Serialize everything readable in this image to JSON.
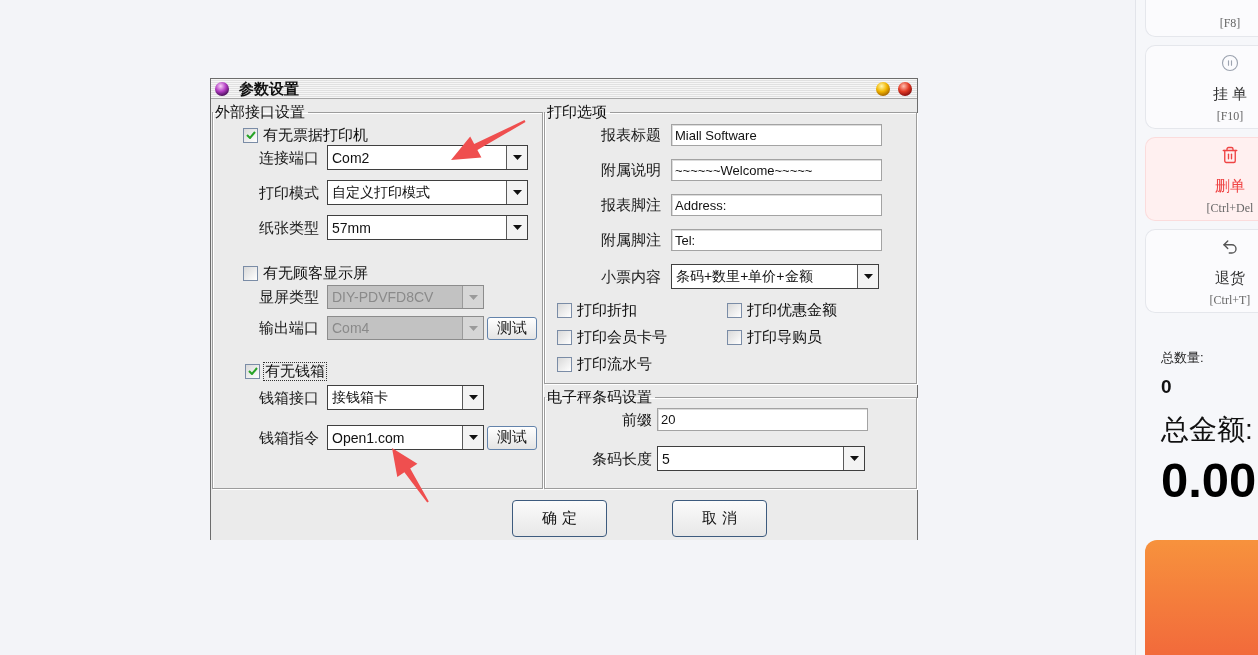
{
  "dialog": {
    "title": "参数设置",
    "interface_group": {
      "title": "外部接口设置",
      "sections": [
        {
          "checkbox": {
            "label": "有无票据打印机",
            "checked": true,
            "focused": false
          },
          "fields": [
            {
              "label": "连接端口",
              "value": "Com2",
              "disabled": false
            },
            {
              "label": "打印模式",
              "value": "自定义打印模式",
              "disabled": false
            },
            {
              "label": "纸张类型",
              "value": "57mm",
              "disabled": false
            }
          ]
        },
        {
          "checkbox": {
            "label": "有无顾客显示屏",
            "checked": false,
            "focused": false
          },
          "fields": [
            {
              "label": "显屏类型",
              "value": "DIY-PDVFD8CV",
              "disabled": true
            },
            {
              "label": "输出端口",
              "value": "Com4",
              "disabled": true,
              "button": "测试"
            }
          ]
        },
        {
          "checkbox": {
            "label": "有无钱箱",
            "checked": true,
            "focused": true
          },
          "fields": [
            {
              "label": "钱箱接口",
              "value": "接钱箱卡",
              "disabled": false
            },
            {
              "label": "钱箱指令",
              "value": "Open1.com",
              "disabled": false,
              "button": "测试"
            }
          ]
        }
      ]
    },
    "print_group": {
      "title": "打印选项",
      "fields": [
        {
          "kind": "text",
          "label": "报表标题",
          "value": "Miall Software"
        },
        {
          "kind": "text",
          "label": "附属说明",
          "value": "~~~~~~Welcome~~~~~"
        },
        {
          "kind": "text",
          "label": "报表脚注",
          "value": "Address:"
        },
        {
          "kind": "text",
          "label": "附属脚注",
          "value": "Tel:"
        },
        {
          "kind": "select",
          "label": "小票内容",
          "value": "条码+数里+单价+金额"
        }
      ],
      "checkboxes": [
        {
          "label": "打印折扣",
          "checked": false
        },
        {
          "label": "打印优惠金额",
          "checked": false
        },
        {
          "label": "打印会员卡号",
          "checked": false
        },
        {
          "label": "打印导购员",
          "checked": false
        },
        {
          "label": "打印流水号",
          "checked": false
        }
      ]
    },
    "scale_group": {
      "title": "电子秤条码设置",
      "fields": [
        {
          "kind": "text",
          "label": "前缀",
          "value": "20"
        },
        {
          "kind": "select",
          "label": "条码长度",
          "value": "5"
        }
      ]
    },
    "buttons": [
      {
        "label": "确 定"
      },
      {
        "label": "取 消"
      }
    ]
  },
  "side_panel": {
    "actions": [
      {
        "kind": "partial",
        "shortcut": "[F8]",
        "danger": false
      },
      {
        "kind": "hold",
        "label": "挂 单",
        "shortcut": "[F10]",
        "danger": false
      },
      {
        "kind": "delete",
        "label": "删单",
        "shortcut": "[Ctrl+Del",
        "danger": true
      },
      {
        "kind": "return",
        "label": "退货",
        "shortcut": "[Ctrl+T]",
        "danger": false
      }
    ],
    "summary": {
      "quantity_label": "总数量:",
      "quantity": "0",
      "amount_label": "总金额:",
      "amount": "0.00"
    }
  }
}
